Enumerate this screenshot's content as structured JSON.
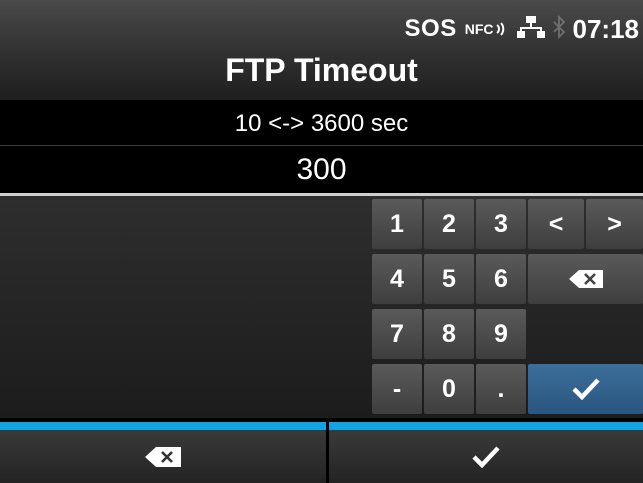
{
  "status": {
    "sos_label": "SOS",
    "nfc_label": "NFC",
    "time": "07:18"
  },
  "title": "FTP Timeout",
  "range_text": "10 <-> 3600 sec",
  "value": "300",
  "keypad": {
    "rows": [
      [
        "1",
        "2",
        "3"
      ],
      [
        "4",
        "5",
        "6"
      ],
      [
        "7",
        "8",
        "9"
      ],
      [
        "-",
        "0",
        "."
      ]
    ],
    "cursor_left": "<",
    "cursor_right": ">",
    "ok_color": "#2d5b85"
  },
  "icons": {
    "backspace": "backspace-icon",
    "confirm": "checkmark-icon",
    "network": "network-icon",
    "nfc": "nfc-icon",
    "bluetooth": "bluetooth-icon"
  },
  "colors": {
    "accent": "#12a4e0",
    "ok_key": "#2d5b85",
    "key": "#4d4d4d"
  }
}
